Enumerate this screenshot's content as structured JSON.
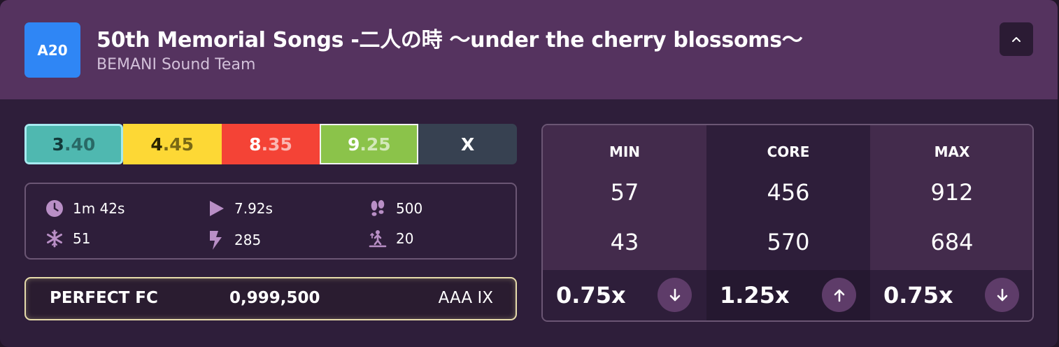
{
  "header": {
    "badge": "A20",
    "title": "50th Memorial Songs -二人の時 〜under the cherry blossoms〜",
    "artist": "BEMANI Sound Team"
  },
  "difficulties": [
    {
      "int": "3",
      "dec": ".40",
      "bg": "#4fb8b0",
      "fg": "#123a3a"
    },
    {
      "int": "4",
      "dec": ".45",
      "bg": "#fdd835",
      "fg": "#2a2400"
    },
    {
      "int": "8",
      "dec": ".35",
      "bg": "#f44336",
      "fg": "#ffffff"
    },
    {
      "int": "9",
      "dec": ".25",
      "bg": "#8bc34a",
      "fg": "#ffffff"
    },
    {
      "int": "X",
      "dec": "",
      "bg": "#374151",
      "fg": "#ffffff"
    }
  ],
  "stats": {
    "length": "1m 42s",
    "first_note": "7.92s",
    "steps": "500",
    "freeze": "51",
    "shock": "285",
    "jumps": "20"
  },
  "score": {
    "lamp": "PERFECT FC",
    "points": "0,999,500",
    "grade": "AAA IX"
  },
  "bpm": {
    "min": {
      "label": "MIN",
      "v1": "57",
      "v2": "43",
      "mult": "0.75x",
      "dir": "down"
    },
    "core": {
      "label": "CORE",
      "v1": "456",
      "v2": "570",
      "mult": "1.25x",
      "dir": "up"
    },
    "max": {
      "label": "MAX",
      "v1": "912",
      "v2": "684",
      "mult": "0.75x",
      "dir": "down"
    }
  },
  "colors": {
    "header_bg": "#55335f",
    "card_bg": "#2e1e3a",
    "icon": "#b98fc6",
    "badge": "#2f86f5"
  }
}
